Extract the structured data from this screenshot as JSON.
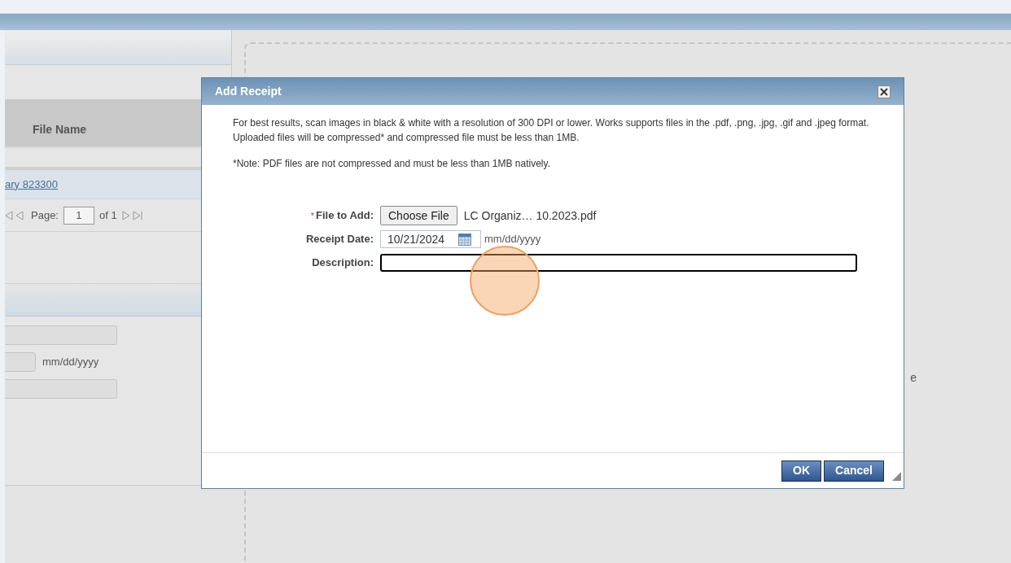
{
  "left_panel": {
    "grid": {
      "column": "File Name",
      "rows": [
        {
          "file_link": "ary 823300"
        }
      ],
      "pager": {
        "page_label": "Page:",
        "page_value": "1",
        "of_label": "of 1"
      }
    },
    "form": {
      "date_hint": "mm/dd/yyyy"
    }
  },
  "background_text": "e",
  "dialog": {
    "title": "Add Receipt",
    "paragraphs": [
      "For best results, scan images in black & white with a resolution of 300 DPI or lower. Works supports files in the .pdf, .png, .jpg, .gif and .jpeg format. Uploaded files will be compressed* and compressed file must be less than 1MB.",
      "*Note: PDF files are not compressed and must be less than 1MB natively."
    ],
    "required_mark": "*",
    "fields": [
      {
        "kind": "file",
        "label": "File to Add:",
        "required": true,
        "focused": false,
        "button": "Choose File",
        "value": "LC Organiz… 10.2023.pdf"
      },
      {
        "kind": "date",
        "label": "Receipt Date:",
        "required": false,
        "focused": false,
        "value": "10/21/2024",
        "hint": "mm/dd/yyyy"
      },
      {
        "kind": "text",
        "label": "Description:",
        "required": false,
        "focused": true
      }
    ],
    "buttons": [
      "OK",
      "Cancel"
    ]
  }
}
